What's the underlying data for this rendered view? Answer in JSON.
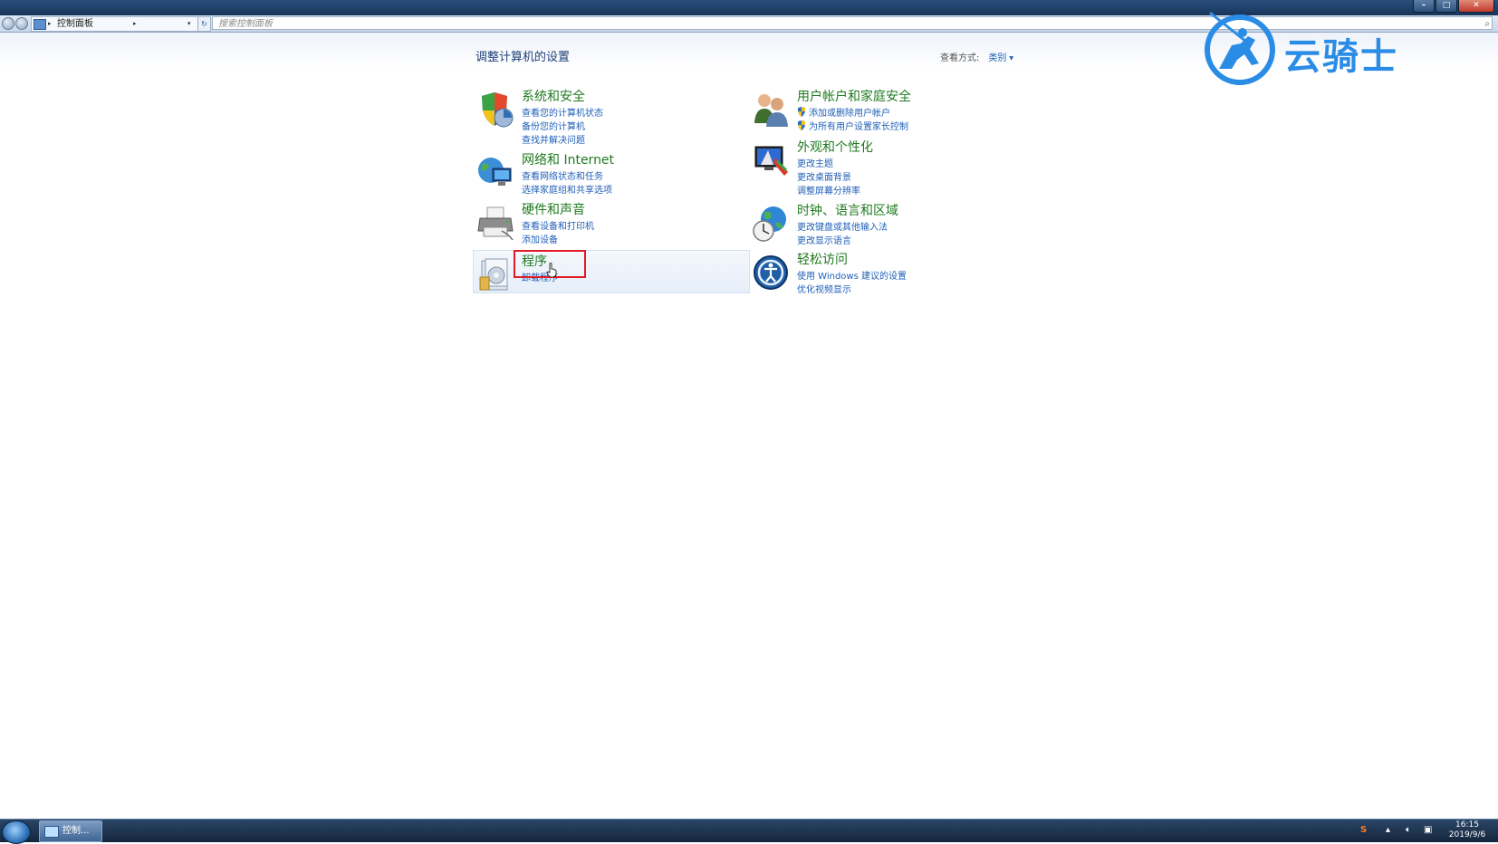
{
  "address_bar": {
    "breadcrumb": "控制面板",
    "search_placeholder": "搜索控制面板"
  },
  "page": {
    "title": "调整计算机的设置",
    "view_by_label": "查看方式:",
    "view_by_value": "类别"
  },
  "categories": [
    {
      "title": "系统和安全",
      "links": [
        "查看您的计算机状态",
        "备份您的计算机",
        "查找并解决问题"
      ],
      "icon": "shield-icon"
    },
    {
      "title": "用户帐户和家庭安全",
      "links": [
        "添加或删除用户帐户",
        "为所有用户设置家长控制"
      ],
      "icon": "users-icon"
    },
    {
      "title": "网络和 Internet",
      "links": [
        "查看网络状态和任务",
        "选择家庭组和共享选项"
      ],
      "icon": "network-icon"
    },
    {
      "title": "外观和个性化",
      "links": [
        "更改主题",
        "更改桌面背景",
        "调整屏幕分辨率"
      ],
      "icon": "monitor-icon"
    },
    {
      "title": "硬件和声音",
      "links": [
        "查看设备和打印机",
        "添加设备"
      ],
      "icon": "printer-icon"
    },
    {
      "title": "时钟、语言和区域",
      "links": [
        "更改键盘或其他输入法",
        "更改显示语言"
      ],
      "icon": "globe-clock-icon"
    },
    {
      "title": "程序",
      "links": [
        "卸载程序"
      ],
      "icon": "programs-icon"
    },
    {
      "title": "轻松访问",
      "links": [
        "使用 Windows 建议的设置",
        "优化视频显示"
      ],
      "icon": "accessibility-icon"
    }
  ],
  "watermark": {
    "text": "云骑士"
  },
  "taskbar": {
    "task_label": "控制...",
    "time": "16:15",
    "date": "2019/9/6"
  },
  "colors": {
    "category_title": "#1f7a1f",
    "link": "#1f5fb8",
    "highlight": "#e21b23"
  }
}
